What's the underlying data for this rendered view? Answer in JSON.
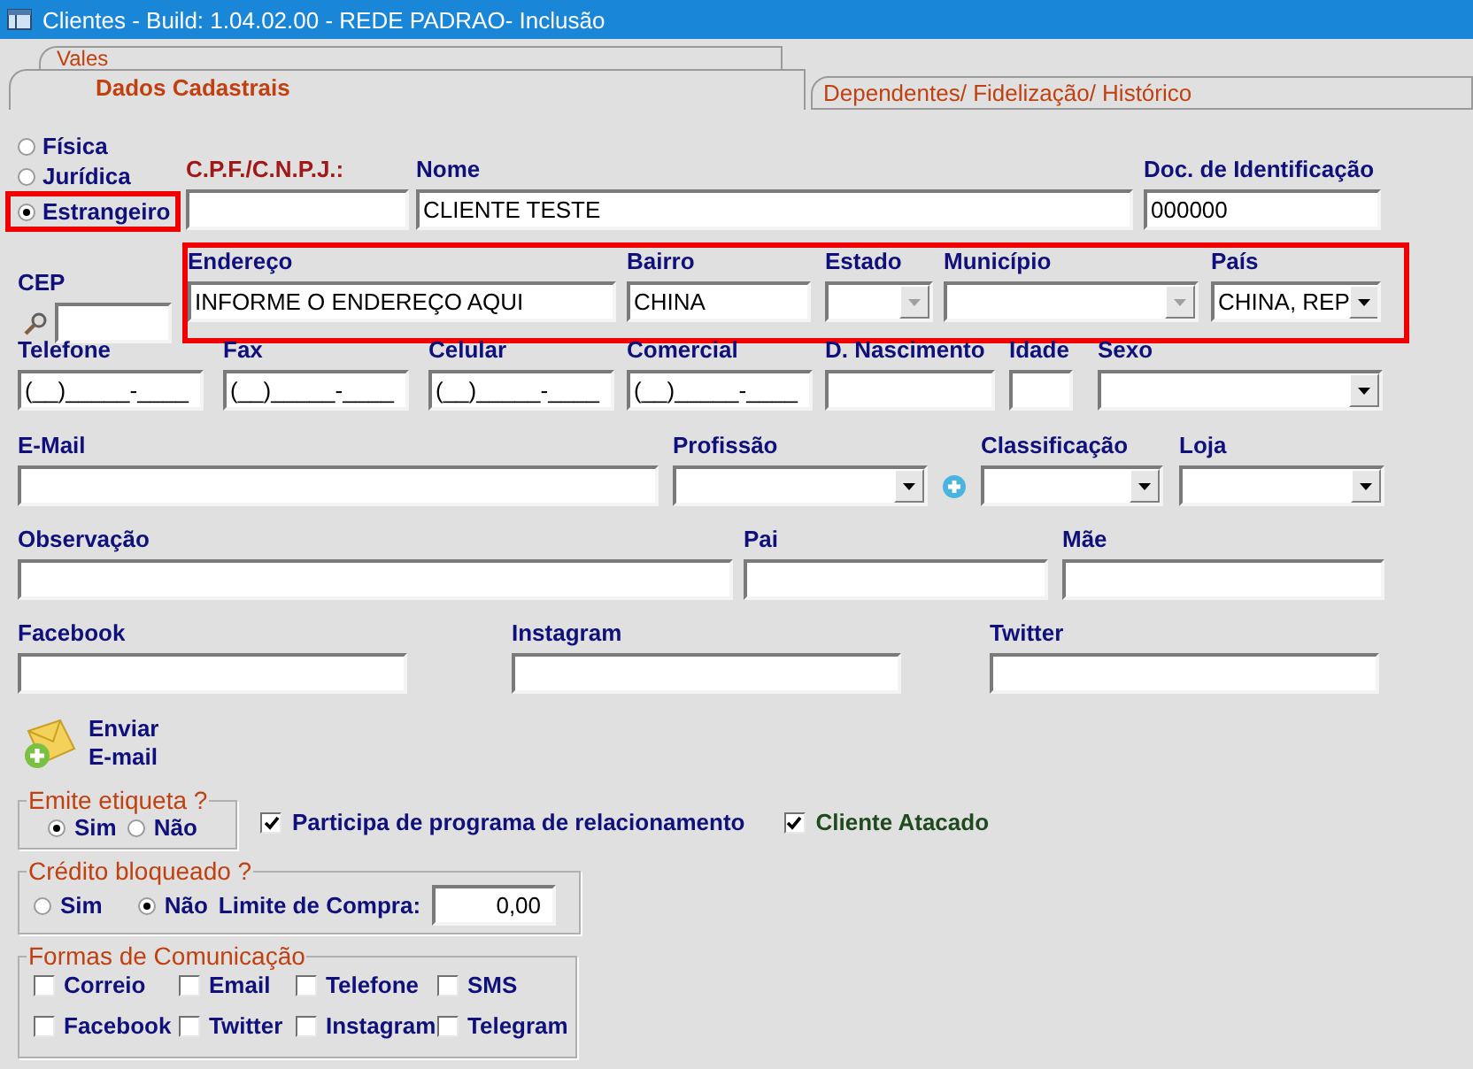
{
  "window": {
    "title": "Clientes - Build: 1.04.02.00 - REDE PADRAO- Inclusão"
  },
  "tabs": [
    {
      "label": "Vales",
      "selected": false
    },
    {
      "label": "Dados Cadastrais",
      "selected": true
    },
    {
      "label": "Dependentes/ Fidelização/ Histórico",
      "selected": false
    }
  ],
  "person_type": [
    {
      "label": "Física",
      "selected": false,
      "highlighted": false
    },
    {
      "label": "Jurídica",
      "selected": false,
      "highlighted": false
    },
    {
      "label": "Estrangeiro",
      "selected": true,
      "highlighted": true
    }
  ],
  "rows": [
    {
      "highlighted": false,
      "fields": [
        {
          "label": "C.P.F./C.N.P.J.:",
          "kind": "text",
          "color": "#a01818"
        },
        {
          "label": "Nome",
          "value": "CLIENTE TESTE",
          "kind": "text",
          "color": "#10107a"
        },
        {
          "label": "Doc. de Identificação",
          "value": "000000",
          "kind": "text",
          "color": "#10107a"
        }
      ]
    },
    {
      "highlighted": true,
      "fields": [
        {
          "label": "CEP",
          "kind": "search",
          "color": "#10107a"
        },
        {
          "label": "Endereço",
          "value": "INFORME O ENDEREÇO AQUI",
          "kind": "text",
          "color": "#10107a"
        },
        {
          "label": "Bairro",
          "value": "CHINA",
          "kind": "text",
          "color": "#10107a"
        },
        {
          "label": "Estado",
          "kind": "combo",
          "disabled": true,
          "color": "#10107a"
        },
        {
          "label": "Município",
          "kind": "combo",
          "disabled": true,
          "color": "#10107a"
        },
        {
          "label": "País",
          "value": "CHINA, REP",
          "kind": "combo",
          "disabled": false,
          "color": "#10107a"
        }
      ]
    },
    {
      "highlighted": false,
      "fields": [
        {
          "label": "Telefone",
          "value": "(__)_____-____",
          "kind": "text",
          "color": "#10107a"
        },
        {
          "label": "Fax",
          "value": "(__)_____-____",
          "kind": "text",
          "color": "#10107a"
        },
        {
          "label": "Celular",
          "value": "(__)_____-____",
          "kind": "text",
          "color": "#10107a"
        },
        {
          "label": "Comercial",
          "value": "(__)_____-____",
          "kind": "text",
          "color": "#10107a"
        },
        {
          "label": "D. Nascimento",
          "kind": "text",
          "color": "#10107a"
        },
        {
          "label": "Idade",
          "kind": "text",
          "color": "#10107a"
        },
        {
          "label": "Sexo",
          "kind": "combo",
          "disabled": false,
          "color": "#10107a"
        }
      ]
    },
    {
      "highlighted": false,
      "fields": [
        {
          "label": "E-Mail",
          "kind": "text",
          "color": "#10107a"
        },
        {
          "label": "Profissão",
          "kind": "combo_add",
          "disabled": false,
          "color": "#10107a"
        },
        {
          "label": "Classificação",
          "kind": "combo",
          "disabled": false,
          "color": "#10107a"
        },
        {
          "label": "Loja",
          "kind": "combo",
          "disabled": false,
          "color": "#10107a"
        }
      ]
    },
    {
      "highlighted": false,
      "fields": [
        {
          "label": "Observação",
          "kind": "text",
          "color": "#10107a"
        },
        {
          "label": "Pai",
          "kind": "text",
          "color": "#10107a"
        },
        {
          "label": "Mãe",
          "kind": "text",
          "color": "#10107a"
        }
      ]
    },
    {
      "highlighted": false,
      "fields": [
        {
          "label": "Facebook",
          "kind": "text",
          "color": "#10107a"
        },
        {
          "label": "Instagram",
          "kind": "text",
          "color": "#10107a"
        },
        {
          "label": "Twitter",
          "kind": "text",
          "color": "#10107a"
        }
      ]
    }
  ],
  "send_email": {
    "lines": [
      "Enviar",
      "E-mail"
    ]
  },
  "label_group": {
    "title": "Emite etiqueta ?",
    "options": [
      {
        "label": "Sim",
        "selected": true
      },
      {
        "label": "Não",
        "selected": false
      }
    ]
  },
  "flags": [
    {
      "label": "Participa de programa de relacionamento",
      "checked": true,
      "color": "#10107a"
    },
    {
      "label": "Cliente Atacado",
      "checked": true,
      "color": "#1e4a1e"
    }
  ],
  "credit_group": {
    "title": "Crédito bloqueado ?",
    "options": [
      {
        "label": "Sim",
        "selected": false
      },
      {
        "label": "Não",
        "selected": true
      }
    ],
    "limit_label": "Limite de Compra:",
    "limit_value": "0,00"
  },
  "communication": {
    "title": "Formas de Comunicação",
    "options": [
      {
        "label": "Correio",
        "checked": false
      },
      {
        "label": "Email",
        "checked": false
      },
      {
        "label": "Telefone",
        "checked": false
      },
      {
        "label": "SMS",
        "checked": false
      },
      {
        "label": "Facebook",
        "checked": false
      },
      {
        "label": "Twitter",
        "checked": false
      },
      {
        "label": "Instagram",
        "checked": false
      },
      {
        "label": "Telegram",
        "checked": false
      }
    ]
  }
}
